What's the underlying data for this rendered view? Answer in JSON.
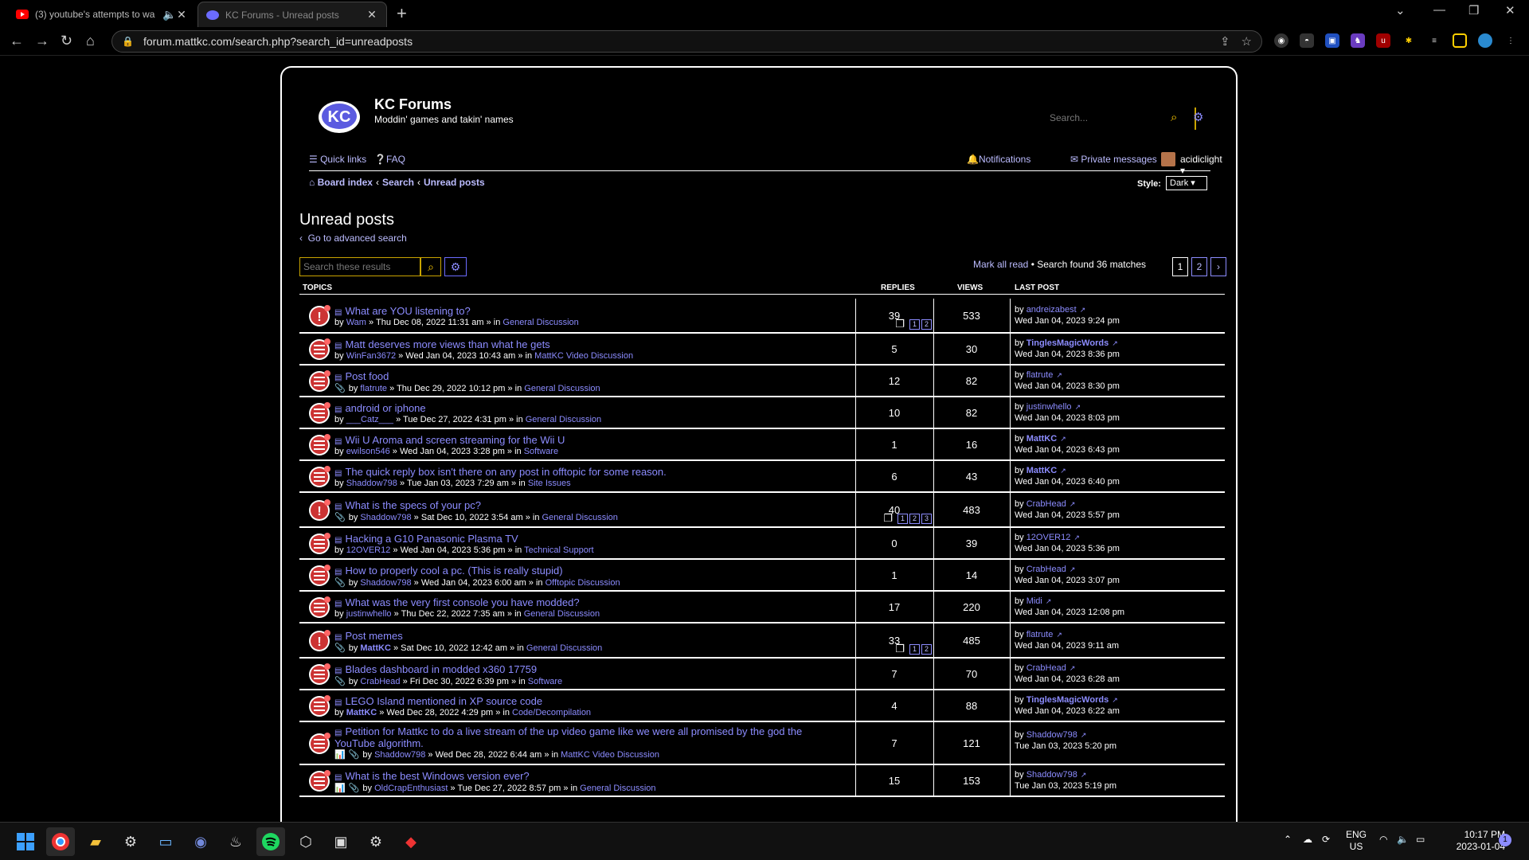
{
  "browser": {
    "tabs": [
      {
        "title": "(3) youtube's attempts to wa",
        "active": false
      },
      {
        "title": "KC Forums - Unread posts",
        "active": true
      }
    ],
    "url": "forum.mattkc.com/search.php?search_id=unreadposts"
  },
  "site": {
    "title": "KC Forums",
    "description": "Moddin' games and takin' names",
    "search_placeholder": "Search..."
  },
  "nav": {
    "quick_links": "Quick links",
    "faq": "FAQ",
    "notifications": "Notifications",
    "private_messages": "Private messages",
    "username": "acidiclight"
  },
  "breadcrumbs": [
    "Board index",
    "Search",
    "Unread posts"
  ],
  "style": {
    "label": "Style:",
    "value": "Dark"
  },
  "heading": "Unread posts",
  "advanced_link": "Go to advanced search",
  "results_search_placeholder": "Search these results",
  "mark_all_read": "Mark all read",
  "search_found": "Search found 36 matches",
  "pages": [
    "1",
    "2"
  ],
  "columns": {
    "topics": "TOPICS",
    "replies": "REPLIES",
    "views": "VIEWS",
    "last_post": "LAST POST"
  },
  "topics": [
    {
      "title": "What are YOU listening to?",
      "author": "Wam",
      "date": "Thu Dec 08, 2022 11:31 am",
      "forum": "General Discussion",
      "replies": "39",
      "views": "533",
      "last_by": "andreizabest",
      "last_date": "Wed Jan 04, 2023 9:24 pm",
      "pages": [
        "1",
        "2"
      ],
      "hot": true
    },
    {
      "title": "Matt deserves more views than what he gets",
      "author": "WinFan3672",
      "date": "Wed Jan 04, 2023 10:43 am",
      "forum": "MattKC Video Discussion",
      "replies": "5",
      "views": "30",
      "last_by": "TinglesMagicWords",
      "last_date": "Wed Jan 04, 2023 8:36 pm",
      "bold_last": true
    },
    {
      "title": "Post food",
      "author": "flatrute",
      "date": "Thu Dec 29, 2022 10:12 pm",
      "forum": "General Discussion",
      "replies": "12",
      "views": "82",
      "last_by": "flatrute",
      "last_date": "Wed Jan 04, 2023 8:30 pm",
      "attach": true
    },
    {
      "title": "android or iphone",
      "author": "___Catz___",
      "date": "Tue Dec 27, 2022 4:31 pm",
      "forum": "General Discussion",
      "replies": "10",
      "views": "82",
      "last_by": "justinwhello",
      "last_date": "Wed Jan 04, 2023 8:03 pm"
    },
    {
      "title": "Wii U Aroma and screen streaming for the Wii U",
      "author": "ewilson546",
      "date": "Wed Jan 04, 2023 3:28 pm",
      "forum": "Software",
      "replies": "1",
      "views": "16",
      "last_by": "MattKC",
      "last_date": "Wed Jan 04, 2023 6:43 pm",
      "bold_last": true
    },
    {
      "title": "The quick reply box isn't there on any post in offtopic for some reason.",
      "author": "Shaddow798",
      "date": "Tue Jan 03, 2023 7:29 am",
      "forum": "Site Issues",
      "replies": "6",
      "views": "43",
      "last_by": "MattKC",
      "last_date": "Wed Jan 04, 2023 6:40 pm",
      "bold_last": true
    },
    {
      "title": "What is the specs of your pc?",
      "author": "Shaddow798",
      "date": "Sat Dec 10, 2022 3:54 am",
      "forum": "General Discussion",
      "replies": "40",
      "views": "483",
      "last_by": "CrabHead",
      "last_date": "Wed Jan 04, 2023 5:57 pm",
      "pages": [
        "1",
        "2",
        "3"
      ],
      "attach": true,
      "hot": true
    },
    {
      "title": "Hacking a G10 Panasonic Plasma TV",
      "author": "12OVER12",
      "date": "Wed Jan 04, 2023 5:36 pm",
      "forum": "Technical Support",
      "replies": "0",
      "views": "39",
      "last_by": "12OVER12",
      "last_date": "Wed Jan 04, 2023 5:36 pm"
    },
    {
      "title": "How to properly cool a pc. (This is really stupid)",
      "author": "Shaddow798",
      "date": "Wed Jan 04, 2023 6:00 am",
      "forum": "Offtopic Discussion",
      "replies": "1",
      "views": "14",
      "last_by": "CrabHead",
      "last_date": "Wed Jan 04, 2023 3:07 pm",
      "attach": true
    },
    {
      "title": "What was the very first console you have modded?",
      "author": "justinwhello",
      "date": "Thu Dec 22, 2022 7:35 am",
      "forum": "General Discussion",
      "replies": "17",
      "views": "220",
      "last_by": "Midi",
      "last_date": "Wed Jan 04, 2023 12:08 pm"
    },
    {
      "title": "Post memes",
      "author": "MattKC",
      "date": "Sat Dec 10, 2022 12:42 am",
      "forum": "General Discussion",
      "replies": "33",
      "views": "485",
      "last_by": "flatrute",
      "last_date": "Wed Jan 04, 2023 9:11 am",
      "pages": [
        "1",
        "2"
      ],
      "attach": true,
      "hot": true,
      "bold_author": true
    },
    {
      "title": "Blades dashboard in modded x360 17759",
      "author": "CrabHead",
      "date": "Fri Dec 30, 2022 6:39 pm",
      "forum": "Software",
      "replies": "7",
      "views": "70",
      "last_by": "CrabHead",
      "last_date": "Wed Jan 04, 2023 6:28 am",
      "attach": true
    },
    {
      "title": "LEGO Island mentioned in XP source code",
      "author": "MattKC",
      "date": "Wed Dec 28, 2022 4:29 pm",
      "forum": "Code/Decompilation",
      "replies": "4",
      "views": "88",
      "last_by": "TinglesMagicWords",
      "last_date": "Wed Jan 04, 2023 6:22 am",
      "bold_last": true,
      "bold_author": true
    },
    {
      "title": "Petition for Mattkc to do a live stream of the up video game like we were all promised by the god the",
      "title2": "YouTube algorithm.",
      "author": "Shaddow798",
      "date": "Wed Dec 28, 2022 6:44 am",
      "forum": "MattKC Video Discussion",
      "replies": "7",
      "views": "121",
      "last_by": "Shaddow798",
      "last_date": "Tue Jan 03, 2023 5:20 pm",
      "attach": true,
      "poll": true
    },
    {
      "title": "What is the best Windows version ever?",
      "author": "OldCrapEnthusiast",
      "date": "Tue Dec 27, 2022 8:57 pm",
      "forum": "General Discussion",
      "replies": "15",
      "views": "153",
      "last_by": "Shaddow798",
      "last_date": "Tue Jan 03, 2023 5:19 pm",
      "attach": true,
      "poll": true
    }
  ],
  "taskbar": {
    "lang": "ENG",
    "region": "US",
    "time": "10:17 PM",
    "date": "2023-01-04",
    "notif_count": "1"
  }
}
